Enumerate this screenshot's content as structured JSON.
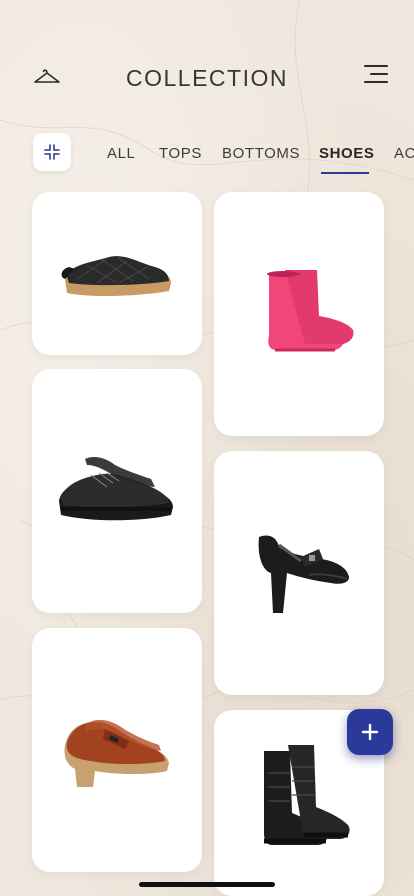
{
  "header": {
    "title": "COLLECTION",
    "left_icon": "hanger-icon",
    "right_icon": "menu-icon"
  },
  "tabs": {
    "collapse_icon": "collapse-icon",
    "items": [
      {
        "label": "ALL",
        "active": false
      },
      {
        "label": "TOPS",
        "active": false
      },
      {
        "label": "BOTTOMS",
        "active": false
      },
      {
        "label": "SHOES",
        "active": true
      },
      {
        "label": "AC",
        "active": false
      }
    ],
    "accent_color": "#2e3a8c"
  },
  "items": [
    {
      "name": "black quilted platform slip-on",
      "icon": "shoe-image"
    },
    {
      "name": "pink rubber ankle boots",
      "icon": "shoe-image"
    },
    {
      "name": "black leather platform derby",
      "icon": "shoe-image"
    },
    {
      "name": "black patent mary jane heels",
      "icon": "shoe-image"
    },
    {
      "name": "brown leather platform loafers",
      "icon": "shoe-image"
    },
    {
      "name": "black leather combat boots",
      "icon": "shoe-image"
    }
  ],
  "fab": {
    "icon": "plus-icon",
    "color": "#2b3a9a"
  }
}
